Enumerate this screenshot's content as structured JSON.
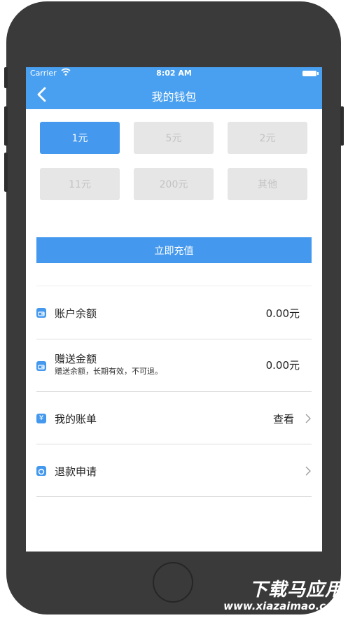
{
  "status_bar": {
    "carrier": "Carrier",
    "time": "8:02 AM"
  },
  "nav": {
    "title": "我的钱包",
    "back_icon": "chevron-left-icon"
  },
  "amounts": [
    {
      "label": "1元",
      "selected": true
    },
    {
      "label": "5元",
      "selected": false
    },
    {
      "label": "2元",
      "selected": false
    },
    {
      "label": "11元",
      "selected": false
    },
    {
      "label": "200元",
      "selected": false
    },
    {
      "label": "其他",
      "selected": false
    }
  ],
  "recharge_button": "立即充值",
  "rows": {
    "balance": {
      "label": "账户余额",
      "value": "0.00元",
      "icon": "wallet-icon"
    },
    "gift": {
      "label": "赠送金额",
      "sub": "赠送余额，长期有效，不可退。",
      "value": "0.00元",
      "icon": "wallet-icon"
    },
    "bill": {
      "label": "我的账单",
      "link": "查看",
      "icon": "yen-icon"
    },
    "refund": {
      "label": "退款申请",
      "icon": "refund-icon"
    }
  },
  "colors": {
    "accent": "#4499ee",
    "nav": "#4aa0f0",
    "disabled_bg": "#e6e6e6",
    "disabled_text": "#c2c2c2"
  },
  "watermark": {
    "title": "下载马应用",
    "url": "www.xiazaimao.com"
  }
}
